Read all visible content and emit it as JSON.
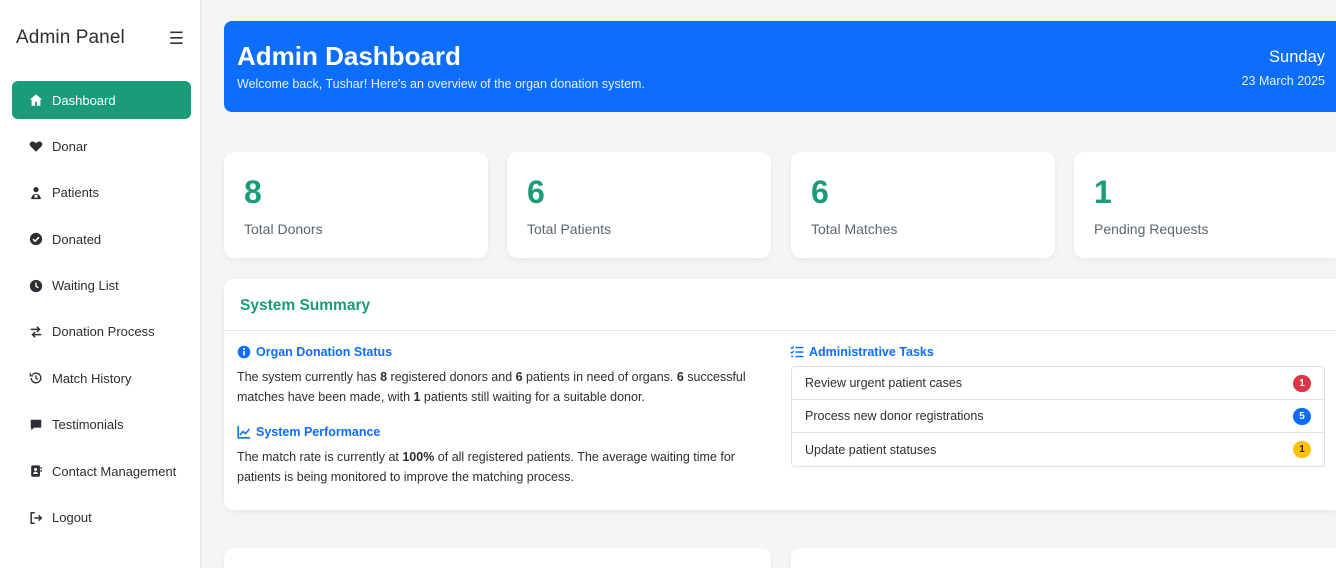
{
  "sidebar": {
    "brand": "Admin Panel",
    "menu_icon": "hamburger-icon",
    "items": [
      {
        "label": "Dashboard",
        "icon": "home-icon",
        "active": true
      },
      {
        "label": "Donar",
        "icon": "heart-icon"
      },
      {
        "label": "Patients",
        "icon": "patient-icon"
      },
      {
        "label": "Donated",
        "icon": "check-circle-icon"
      },
      {
        "label": "Waiting List",
        "icon": "clock-icon"
      },
      {
        "label": "Donation Process",
        "icon": "exchange-icon"
      },
      {
        "label": "Match History",
        "icon": "history-icon"
      },
      {
        "label": "Testimonials",
        "icon": "comment-icon"
      },
      {
        "label": "Contact Management",
        "icon": "address-book-icon"
      },
      {
        "label": "Logout",
        "icon": "logout-icon"
      }
    ]
  },
  "header": {
    "title": "Admin Dashboard",
    "subtitle": "Welcome back, Tushar! Here's an overview of the organ donation system.",
    "day": "Sunday",
    "date": "23 March 2025"
  },
  "stats": [
    {
      "value": "8",
      "label": "Total Donors"
    },
    {
      "value": "6",
      "label": "Total Patients"
    },
    {
      "value": "6",
      "label": "Total Matches"
    },
    {
      "value": "1",
      "label": "Pending Requests"
    }
  ],
  "summary": {
    "title": "System Summary",
    "status": {
      "heading": "Organ Donation Status",
      "icon": "info-circle-icon",
      "t1": "The system currently has ",
      "donors": "8",
      "t2": " registered donors and ",
      "patients": "6",
      "t3": " patients in need of organs. ",
      "matches": "6",
      "t4": " successful matches have been made, with ",
      "waiting": "1",
      "t5": " patients still waiting for a suitable donor."
    },
    "performance": {
      "heading": "System Performance",
      "icon": "line-chart-icon",
      "t1": "The match rate is currently at ",
      "rate": "100%",
      "t2": " of all registered patients. The average waiting time for patients is being monitored to improve the matching process."
    },
    "tasks": {
      "heading": "Administrative Tasks",
      "icon": "tasks-list-icon",
      "items": [
        {
          "label": "Review urgent patient cases",
          "count": "1",
          "color": "#dc3545"
        },
        {
          "label": "Process new donor registrations",
          "count": "5",
          "color": "#0d6efd"
        },
        {
          "label": "Update patient statuses",
          "count": "1",
          "color": "#ffc107"
        }
      ]
    }
  },
  "colors": {
    "accent": "#1a9c7b",
    "primary": "#0d6efd",
    "danger": "#dc3545",
    "warning": "#ffc107"
  }
}
